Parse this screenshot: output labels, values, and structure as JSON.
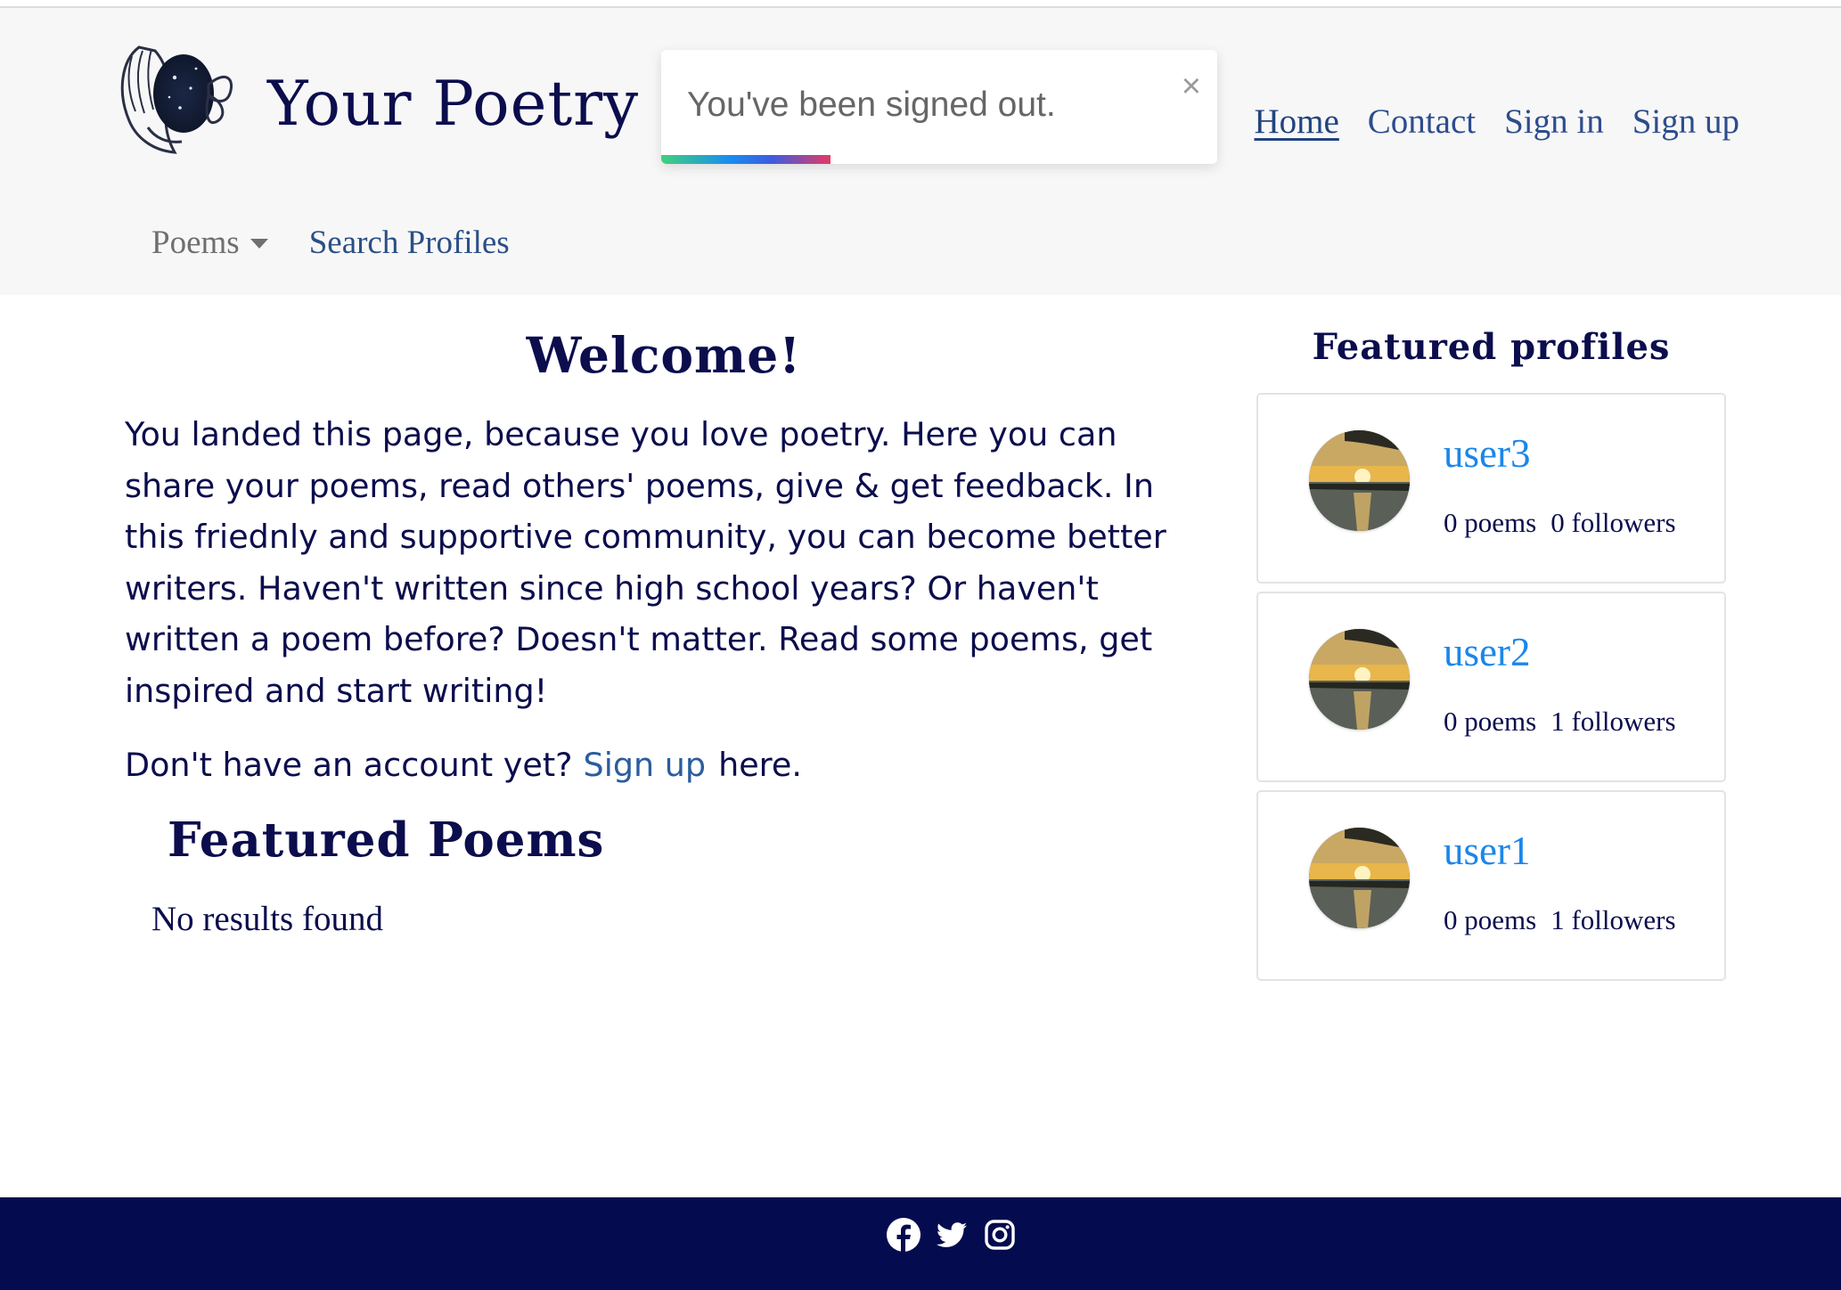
{
  "header": {
    "brand": "Your Poetry",
    "nav": [
      {
        "label": "Home",
        "active": true
      },
      {
        "label": "Contact"
      },
      {
        "label": "Sign in"
      },
      {
        "label": "Sign up"
      }
    ],
    "subnav": {
      "poems": "Poems",
      "search_profiles": "Search Profiles"
    }
  },
  "toast": {
    "message": "You've been signed out.",
    "close": "×"
  },
  "main": {
    "welcome": "Welcome!",
    "intro": "You landed this page, because you love poetry. Here you can share your poems, read others' poems, give & get feedback. In this friednly and supportive community, you can become better writers. Haven't written since high school years? Or haven't written a poem before? Doesn't matter. Read some poems, get inspired and start writing!",
    "account_prefix": "Don't have an account yet?",
    "account_link": "Sign up",
    "account_suffix": "here.",
    "featured_poems_title": "Featured Poems",
    "no_results": "No results found"
  },
  "sidebar": {
    "title": "Featured profiles",
    "profiles": [
      {
        "username": "user3",
        "poems": "0 poems",
        "followers": "0 followers"
      },
      {
        "username": "user2",
        "poems": "0 poems",
        "followers": "1 followers"
      },
      {
        "username": "user1",
        "poems": "0 poems",
        "followers": "1 followers"
      }
    ]
  },
  "footer": {
    "icons": [
      "facebook-icon",
      "twitter-icon",
      "instagram-icon"
    ]
  },
  "colors": {
    "navy": "#0b0d4d",
    "footer_bg": "#050b4f",
    "link_blue": "#1a86ea",
    "header_bg": "#f7f7f7"
  }
}
